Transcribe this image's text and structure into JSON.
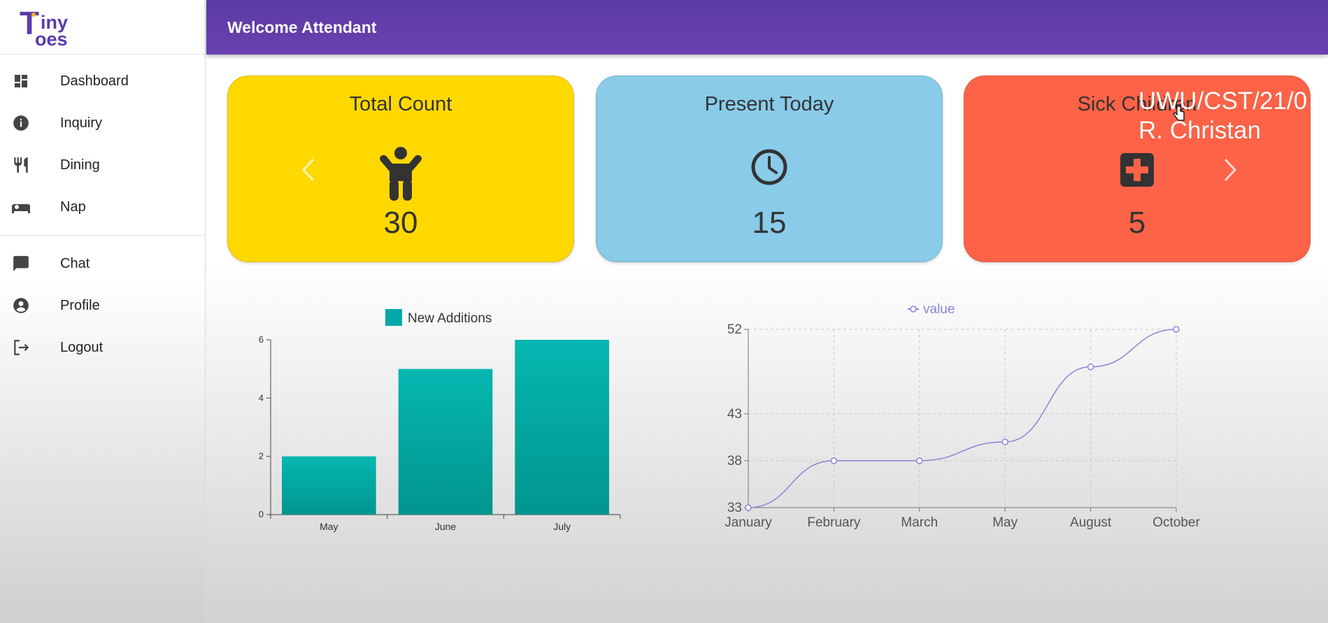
{
  "app": {
    "logo_text": "Tiny Toes",
    "header_title": "Welcome Attendant"
  },
  "sidebar": {
    "items": [
      {
        "label": "Dashboard",
        "icon": "dashboard-icon"
      },
      {
        "label": "Inquiry",
        "icon": "info-icon"
      },
      {
        "label": "Dining",
        "icon": "fork-knife-icon"
      },
      {
        "label": "Nap",
        "icon": "bed-icon"
      },
      {
        "label": "Chat",
        "icon": "chat-icon"
      },
      {
        "label": "Profile",
        "icon": "account-circle-icon"
      },
      {
        "label": "Logout",
        "icon": "logout-icon"
      }
    ]
  },
  "cards": [
    {
      "title": "Total Count",
      "value": "30",
      "icon": "child-icon",
      "color": "#ffd800"
    },
    {
      "title": "Present Today",
      "value": "15",
      "icon": "clock-icon",
      "color": "#89cbe9"
    },
    {
      "title": "Sick Children",
      "value": "5",
      "icon": "medical-cross-icon",
      "color": "#ff6347"
    }
  ],
  "overlay": {
    "line1": "UWU/CST/21/0",
    "line2": "R. Christan"
  },
  "chart_data": [
    {
      "type": "bar",
      "categories": [
        "May",
        "June",
        "July"
      ],
      "series": [
        {
          "name": "New Additions",
          "values": [
            2,
            5,
            6
          ]
        }
      ],
      "ylim": [
        0,
        6
      ],
      "yticks": [
        0,
        2,
        4,
        6
      ],
      "color": "#03a8a8",
      "legend": "top"
    },
    {
      "type": "line",
      "categories": [
        "January",
        "February",
        "March",
        "May",
        "August",
        "October"
      ],
      "series": [
        {
          "name": "value",
          "values": [
            33,
            38,
            38,
            40,
            48,
            52
          ]
        }
      ],
      "ylim": [
        33,
        52
      ],
      "yticks": [
        33,
        38,
        43,
        52
      ],
      "color": "#8884d8",
      "grid": true,
      "legend": "top"
    }
  ]
}
